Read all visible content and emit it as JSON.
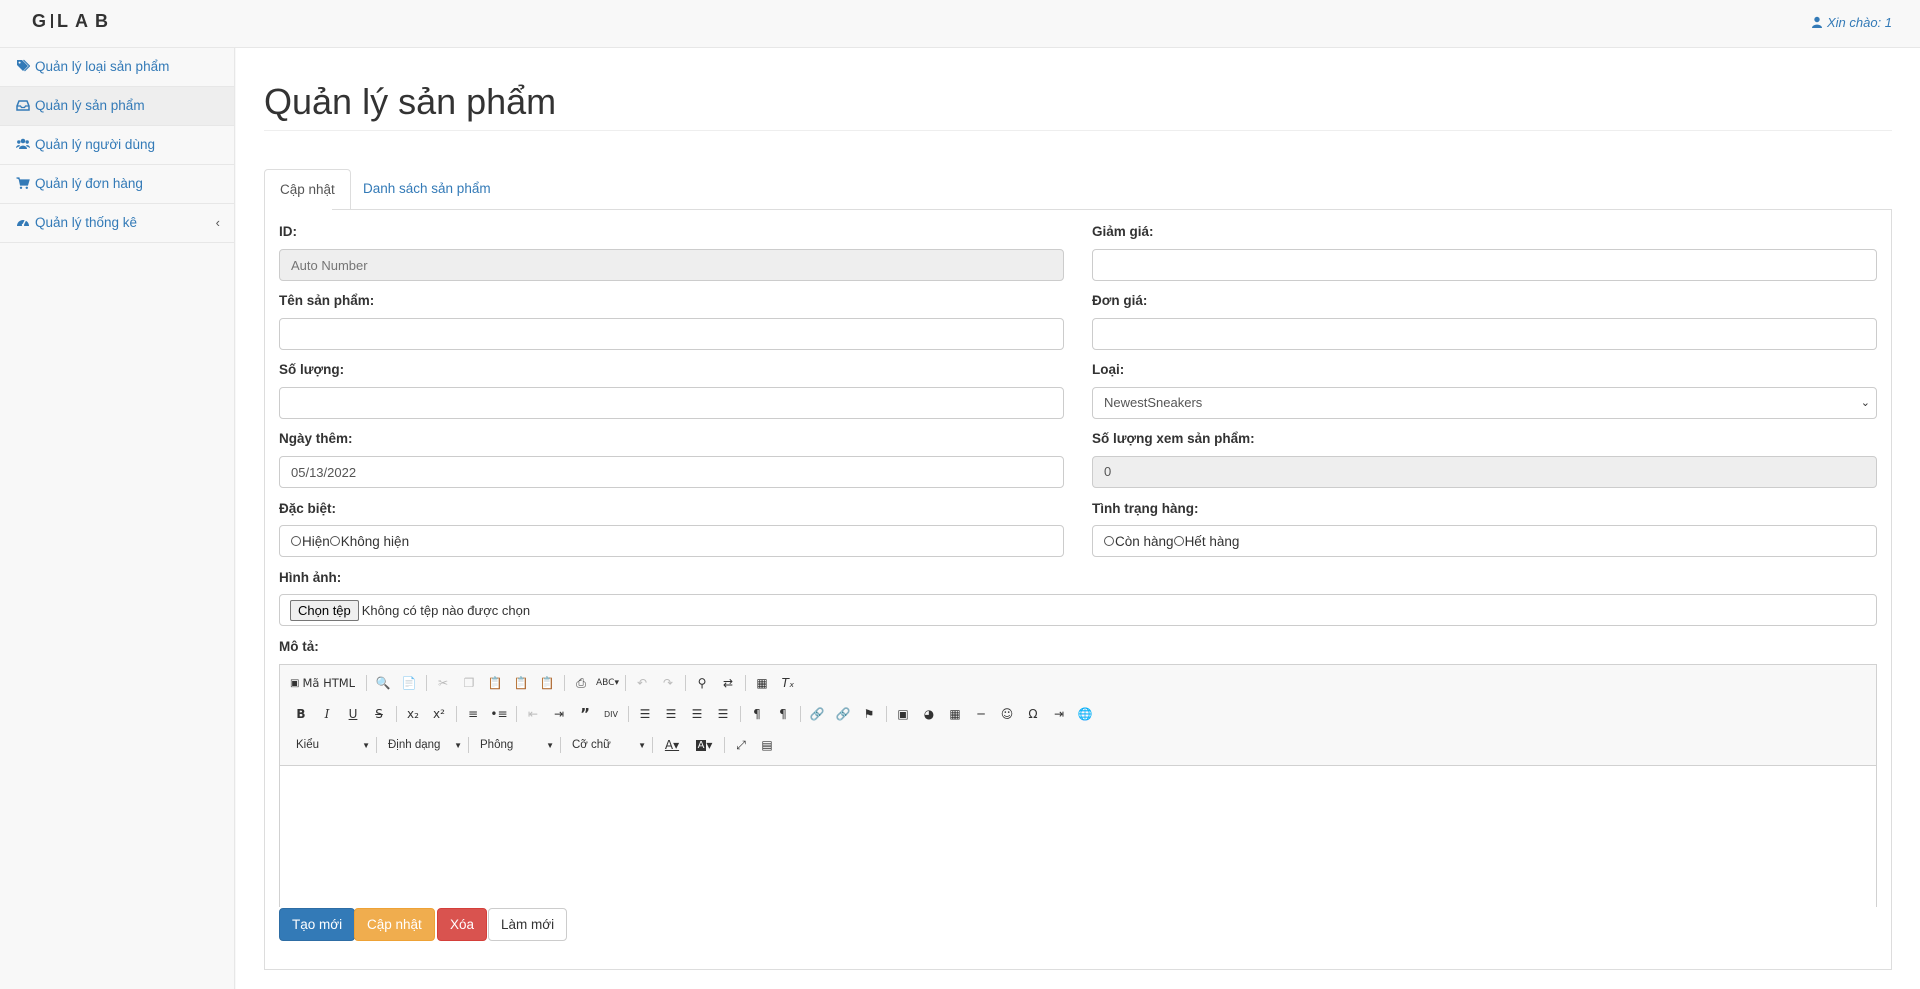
{
  "brand": {
    "left": "G",
    "right": "LAB"
  },
  "header": {
    "greeting": "Xin chào: 1"
  },
  "sidebar": {
    "items": [
      {
        "label": "Quản lý loại sản phẩm",
        "icon": "tags-icon"
      },
      {
        "label": "Quản lý sản phẩm",
        "icon": "inbox-icon"
      },
      {
        "label": "Quản lý người dùng",
        "icon": "users-icon"
      },
      {
        "label": "Quản lý đơn hàng",
        "icon": "cart-icon"
      },
      {
        "label": "Quản lý thống kê",
        "icon": "dashboard-icon"
      }
    ],
    "active_index": 1
  },
  "page": {
    "title": "Quản lý sản phẩm"
  },
  "tabs": [
    {
      "label": "Cập nhật",
      "active": true
    },
    {
      "label": "Danh sách sản phẩm",
      "active": false
    }
  ],
  "form": {
    "id": {
      "label": "ID:",
      "placeholder": "Auto Number"
    },
    "discount": {
      "label": "Giảm giá:",
      "value": ""
    },
    "name": {
      "label": "Tên sản phẩm:",
      "value": ""
    },
    "price": {
      "label": "Đơn giá:",
      "value": ""
    },
    "quantity": {
      "label": "Số lượng:",
      "value": ""
    },
    "category": {
      "label": "Loại:",
      "selected": "NewestSneakers"
    },
    "date_added": {
      "label": "Ngày thêm:",
      "value": "05/13/2022"
    },
    "view_count": {
      "label": "Số lượng xem sản phẩm:",
      "value": "0"
    },
    "special": {
      "label": "Đặc biệt:",
      "options": [
        "Hiện",
        "Không hiện"
      ]
    },
    "stock_status": {
      "label": "Tình trạng hàng:",
      "options": [
        "Còn hàng",
        "Hết hàng"
      ]
    },
    "image": {
      "label": "Hình ảnh:",
      "button": "Chọn tệp",
      "status": "Không có tệp nào được chọn"
    },
    "description": {
      "label": "Mô tả:"
    }
  },
  "editor_toolbar": {
    "source_label": "Mã HTML",
    "combos": [
      "Kiểu",
      "Định dạng",
      "Phông",
      "Cỡ chữ"
    ]
  },
  "actions": {
    "create": "Tạo mới",
    "update": "Cập nhật",
    "delete": "Xóa",
    "reset": "Làm mới"
  },
  "colors": {
    "link": "#337ab7",
    "primary": "#337ab7",
    "warning": "#f0ad4e",
    "danger": "#d9534f"
  }
}
